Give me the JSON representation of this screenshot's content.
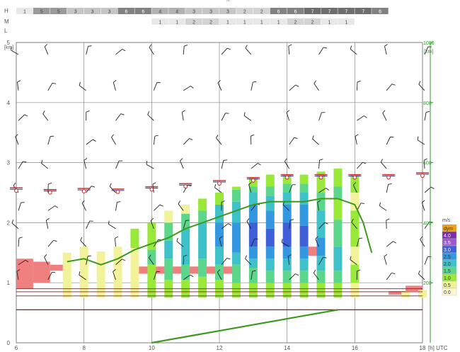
{
  "top_marker": "^",
  "cloud_rows": [
    {
      "label": "H",
      "start_hour": 6.0,
      "cells": [
        "1",
        "5",
        "5",
        "3",
        "3",
        "3",
        "6",
        "6",
        "4",
        "4",
        "3",
        "3",
        "3",
        "2",
        "2",
        "6",
        "6",
        "7",
        "7",
        "7",
        "7",
        "6"
      ]
    },
    {
      "label": "M",
      "start_hour": 10.0,
      "cells": [
        "1",
        "1",
        "2",
        "2",
        "1",
        "1",
        "1",
        "1",
        "2",
        "2",
        "1",
        "1"
      ]
    },
    {
      "label": "L",
      "start_hour": 6.0,
      "cells": []
    }
  ],
  "colors": {
    "cloud_shades": {
      "1": "#e8e8e8",
      "2": "#d4d4d4",
      "3": "#c6c6c6",
      "4": "#b2b2b2",
      "5": "#9a9a9a",
      "6": "#828282",
      "7": "#6e6e6e"
    },
    "grid": "#555555",
    "right_axis": "#2e9a2e",
    "boundary_layer_line": "#3c9a1e",
    "ground_line": "#8b1a1a",
    "stratus_fill": "#f08080"
  },
  "chart_data": {
    "type": "bar",
    "x_axis": {
      "ticks": [
        "6",
        "8",
        "10",
        "12",
        "14",
        "16",
        "18"
      ],
      "unit": "[h] UTC",
      "range": [
        6,
        18
      ]
    },
    "left_axis": {
      "ticks": [
        "0",
        "1",
        "2",
        "3",
        "4",
        "5"
      ],
      "unit": "[km]",
      "range": [
        0,
        5
      ]
    },
    "right_axis": {
      "ticks": [
        "200",
        "400",
        "600",
        "800",
        "1000"
      ],
      "unit": "[km]",
      "range": [
        0,
        1000
      ]
    },
    "legend": {
      "title": "m/s",
      "entries": [
        {
          "label": "dym",
          "color": "#e8a21e"
        },
        {
          "label": "4.0",
          "color": "#7b2fa8"
        },
        {
          "label": "3.5",
          "color": "#9b59d0"
        },
        {
          "label": "3.0",
          "color": "#3f5fd8"
        },
        {
          "label": "2.5",
          "color": "#3498e0"
        },
        {
          "label": "2.0",
          "color": "#3ec1c8"
        },
        {
          "label": "1.5",
          "color": "#5cd68a"
        },
        {
          "label": "1.0",
          "color": "#9ae83a"
        },
        {
          "label": "0.5",
          "color": "#f2f29a"
        },
        {
          "label": "0.0",
          "color": "#fff8d0"
        }
      ]
    },
    "thermal_columns": [
      {
        "hour": 7.5,
        "bottom_km": 0.75,
        "layers": [
          [
            "0.5",
            1.5
          ]
        ]
      },
      {
        "hour": 8.0,
        "bottom_km": 0.75,
        "layers": [
          [
            "0.5",
            1.6
          ]
        ]
      },
      {
        "hour": 8.5,
        "bottom_km": 0.75,
        "layers": [
          [
            "0.5",
            1.52
          ]
        ]
      },
      {
        "hour": 9.0,
        "bottom_km": 0.75,
        "layers": [
          [
            "0.5",
            1.6
          ]
        ]
      },
      {
        "hour": 9.5,
        "bottom_km": 0.75,
        "layers": [
          [
            "0.5",
            1.58
          ],
          [
            "1.0",
            1.9
          ]
        ]
      },
      {
        "hour": 10.0,
        "bottom_km": 0.75,
        "layers": [
          [
            "1.0",
            1.3
          ],
          [
            "1.5",
            1.55
          ],
          [
            "1.0",
            2.0
          ]
        ]
      },
      {
        "hour": 10.5,
        "bottom_km": 0.75,
        "layers": [
          [
            "1.0",
            1.05
          ],
          [
            "1.5",
            1.4
          ],
          [
            "2.0",
            1.7
          ],
          [
            "1.5",
            2.0
          ],
          [
            "0.5",
            2.2
          ]
        ]
      },
      {
        "hour": 11.0,
        "bottom_km": 0.75,
        "layers": [
          [
            "1.0",
            1.05
          ],
          [
            "1.5",
            1.3
          ],
          [
            "2.0",
            1.9
          ],
          [
            "1.5",
            2.15
          ],
          [
            "0.5",
            2.3
          ]
        ]
      },
      {
        "hour": 11.5,
        "bottom_km": 0.75,
        "layers": [
          [
            "1.0",
            1.1
          ],
          [
            "1.5",
            1.4
          ],
          [
            "2.0",
            2.0
          ],
          [
            "1.5",
            2.2
          ],
          [
            "1.0",
            2.4
          ]
        ]
      },
      {
        "hour": 12.0,
        "bottom_km": 0.75,
        "layers": [
          [
            "1.0",
            1.05
          ],
          [
            "1.5",
            1.3
          ],
          [
            "2.0",
            1.6
          ],
          [
            "2.5",
            2.0
          ],
          [
            "2.0",
            2.3
          ],
          [
            "1.0",
            2.5
          ]
        ]
      },
      {
        "hour": 12.5,
        "bottom_km": 0.75,
        "layers": [
          [
            "1.0",
            1.0
          ],
          [
            "1.5",
            1.3
          ],
          [
            "2.0",
            1.5
          ],
          [
            "2.5",
            2.0
          ],
          [
            "2.0",
            2.35
          ],
          [
            "1.5",
            2.55
          ],
          [
            "1.0",
            2.6
          ]
        ]
      },
      {
        "hour": 13.0,
        "bottom_km": 0.75,
        "layers": [
          [
            "1.0",
            1.0
          ],
          [
            "1.5",
            1.25
          ],
          [
            "2.0",
            1.4
          ],
          [
            "2.5",
            1.6
          ],
          [
            "3.0",
            2.0
          ],
          [
            "2.5",
            2.3
          ],
          [
            "2.0",
            2.5
          ],
          [
            "1.5",
            2.6
          ],
          [
            "1.0",
            2.75
          ]
        ]
      },
      {
        "hour": 13.5,
        "bottom_km": 0.75,
        "layers": [
          [
            "1.0",
            1.0
          ],
          [
            "1.5",
            1.2
          ],
          [
            "2.0",
            1.4
          ],
          [
            "2.5",
            1.6
          ],
          [
            "3.0",
            1.9
          ],
          [
            "2.5",
            2.2
          ],
          [
            "2.0",
            2.45
          ],
          [
            "1.5",
            2.6
          ],
          [
            "1.0",
            2.8
          ]
        ]
      },
      {
        "hour": 14.0,
        "bottom_km": 0.75,
        "layers": [
          [
            "1.0",
            1.0
          ],
          [
            "1.5",
            1.2
          ],
          [
            "2.0",
            1.4
          ],
          [
            "2.5",
            1.6
          ],
          [
            "3.0",
            2.0
          ],
          [
            "2.5",
            2.3
          ],
          [
            "2.0",
            2.5
          ],
          [
            "1.5",
            2.65
          ],
          [
            "1.0",
            2.8
          ]
        ]
      },
      {
        "hour": 14.5,
        "bottom_km": 0.75,
        "layers": [
          [
            "1.0",
            1.0
          ],
          [
            "1.5",
            1.2
          ],
          [
            "2.0",
            1.4
          ],
          [
            "2.5",
            1.6
          ],
          [
            "3.0",
            1.95
          ],
          [
            "2.5",
            2.3
          ],
          [
            "2.0",
            2.5
          ],
          [
            "1.5",
            2.65
          ],
          [
            "1.0",
            2.8
          ]
        ]
      },
      {
        "hour": 15.0,
        "bottom_km": 0.75,
        "layers": [
          [
            "1.0",
            1.0
          ],
          [
            "1.5",
            1.2
          ],
          [
            "2.0",
            1.45
          ],
          [
            "2.5",
            1.75
          ],
          [
            "2.0",
            2.2
          ],
          [
            "1.5",
            2.5
          ],
          [
            "1.0",
            2.85
          ]
        ]
      },
      {
        "hour": 15.5,
        "bottom_km": 0.75,
        "layers": [
          [
            "1.0",
            1.0
          ],
          [
            "1.5",
            1.2
          ],
          [
            "2.0",
            1.6
          ],
          [
            "1.5",
            2.05
          ],
          [
            "1.0",
            2.4
          ],
          [
            "1.5",
            2.6
          ],
          [
            "1.0",
            2.9
          ]
        ]
      },
      {
        "hour": 16.0,
        "bottom_km": 0.75,
        "layers": [
          [
            "0.5",
            1.0
          ],
          [
            "1.0",
            1.3
          ],
          [
            "0.5",
            1.6
          ],
          [
            "1.0",
            2.2
          ],
          [
            "0.5",
            2.5
          ],
          [
            "1.0",
            2.8
          ]
        ]
      },
      {
        "hour": 17.5,
        "bottom_km": 0.75,
        "layers": [
          [
            "0.5",
            0.85
          ]
        ]
      },
      {
        "hour": 18.0,
        "bottom_km": 0.75,
        "layers": [
          [
            "0.5",
            0.88
          ]
        ]
      }
    ],
    "stratus_patches": [
      {
        "from": 6.0,
        "to": 6.5,
        "bottom_km": 0.9,
        "top_km": 1.4
      },
      {
        "from": 6.5,
        "to": 7.0,
        "bottom_km": 1.0,
        "top_km": 1.35
      },
      {
        "from": 7.0,
        "to": 7.5,
        "bottom_km": 1.2,
        "top_km": 1.3
      },
      {
        "from": 9.5,
        "to": 12.5,
        "bottom_km": 1.15,
        "top_km": 1.27
      },
      {
        "from": 14.5,
        "to": 15.0,
        "bottom_km": 1.45,
        "top_km": 1.6
      },
      {
        "from": 17.0,
        "to": 17.5,
        "bottom_km": 0.8,
        "top_km": 0.86
      },
      {
        "from": 17.5,
        "to": 18.0,
        "bottom_km": 0.86,
        "top_km": 0.95
      }
    ],
    "boundary_layer": {
      "x": [
        7.5,
        8.0,
        8.5,
        9.0,
        9.5,
        10.0,
        10.5,
        11.0,
        11.5,
        12.0,
        12.5,
        13.0,
        13.5,
        14.0,
        14.5,
        15.0,
        15.5,
        16.0,
        16.25,
        16.5
      ],
      "y": [
        1.35,
        1.4,
        1.3,
        1.4,
        1.55,
        1.65,
        1.75,
        1.9,
        2.0,
        2.1,
        2.2,
        2.3,
        2.35,
        2.35,
        2.35,
        2.4,
        2.4,
        2.3,
        2.0,
        1.5
      ]
    },
    "lower_line": {
      "x": [
        10.0,
        11.0,
        12.0,
        13.0,
        14.0,
        15.0,
        15.5
      ],
      "y": [
        0.0,
        0.1,
        0.2,
        0.3,
        0.4,
        0.5,
        0.55
      ]
    },
    "ground_lines_km": [
      0.55,
      0.78,
      0.85,
      0.9
    ],
    "cloud_base_markers": {
      "hours": [
        6,
        7,
        8,
        9,
        10,
        11,
        12,
        13,
        14,
        15,
        16,
        17,
        18
      ],
      "km": [
        2.58,
        2.55,
        2.57,
        2.56,
        2.6,
        2.65,
        2.7,
        2.75,
        2.8,
        2.8,
        2.8,
        2.8,
        2.83
      ]
    },
    "wind_barb_levels_km": [
      4.8,
      4.2,
      3.7,
      3.3,
      2.9,
      2.5,
      2.2,
      1.9,
      1.6,
      1.3,
      1.05
    ]
  }
}
